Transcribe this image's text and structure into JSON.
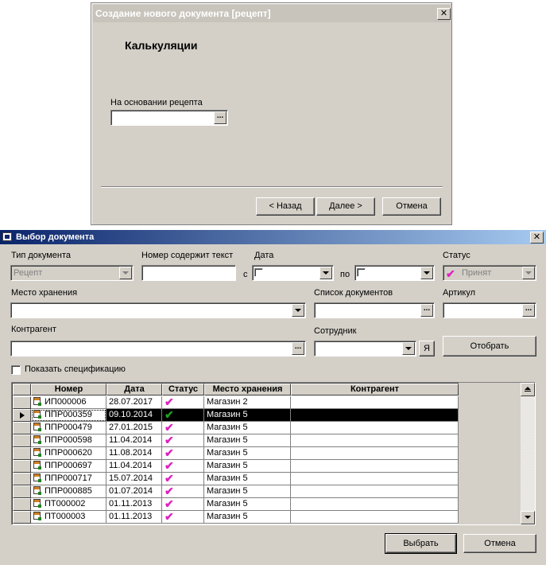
{
  "wizard": {
    "title": "Создание нового документа [рецепт]",
    "heading": "Калькуляции",
    "basis_label": "На основании рецепта",
    "basis_value": "",
    "back_label": "< Назад",
    "next_label": "Далее >",
    "cancel_label": "Отмена"
  },
  "selector": {
    "title": "Выбор документа",
    "doc_type_label": "Тип документа",
    "doc_type_value": "Рецепт",
    "number_label": "Номер содержит текст",
    "number_value": "",
    "date_label": "Дата",
    "date_from_prefix": "с",
    "date_to_prefix": "по",
    "status_label": "Статус",
    "status_value": "Принят",
    "storage_label": "Место хранения",
    "storage_value": "",
    "doclist_label": "Список документов",
    "doclist_value": "",
    "article_label": "Артикул",
    "article_value": "",
    "counterparty_label": "Контрагент",
    "counterparty_value": "",
    "employee_label": "Сотрудник",
    "employee_value": "",
    "me_button": "Я",
    "filter_button": "Отобрать",
    "show_spec_label": "Показать спецификацию",
    "select_button": "Выбрать",
    "cancel_button": "Отмена",
    "columns": [
      "Номер",
      "Дата",
      "Статус",
      "Место хранения",
      "Контрагент"
    ],
    "rows": [
      {
        "number": "ИП000006",
        "date": "28.07.2017",
        "status": "accepted",
        "storage": "Магазин 2",
        "counterparty": ""
      },
      {
        "number": "ППР000359",
        "date": "09.10.2014",
        "status": "accepted",
        "storage": "Магазин 5",
        "counterparty": "",
        "selected": true
      },
      {
        "number": "ППР000479",
        "date": "27.01.2015",
        "status": "accepted",
        "storage": "Магазин 5",
        "counterparty": ""
      },
      {
        "number": "ППР000598",
        "date": "11.04.2014",
        "status": "accepted",
        "storage": "Магазин 5",
        "counterparty": ""
      },
      {
        "number": "ППР000620",
        "date": "11.08.2014",
        "status": "accepted",
        "storage": "Магазин 5",
        "counterparty": ""
      },
      {
        "number": "ППР000697",
        "date": "11.04.2014",
        "status": "accepted",
        "storage": "Магазин 5",
        "counterparty": ""
      },
      {
        "number": "ППР000717",
        "date": "15.07.2014",
        "status": "accepted",
        "storage": "Магазин 5",
        "counterparty": ""
      },
      {
        "number": "ППР000885",
        "date": "01.07.2014",
        "status": "accepted",
        "storage": "Магазин 5",
        "counterparty": ""
      },
      {
        "number": "ПТ000002",
        "date": "01.11.2013",
        "status": "accepted",
        "storage": "Магазин 5",
        "counterparty": ""
      },
      {
        "number": "ПТ000003",
        "date": "01.11.2013",
        "status": "accepted",
        "storage": "Магазин 5",
        "counterparty": ""
      }
    ]
  },
  "colors": {
    "dialog_bg": "#d4d0c8",
    "title_active_start": "#0a246a",
    "title_active_end": "#a6caf0",
    "status_accepted": "#e020c0",
    "status_selected": "#20a020"
  }
}
